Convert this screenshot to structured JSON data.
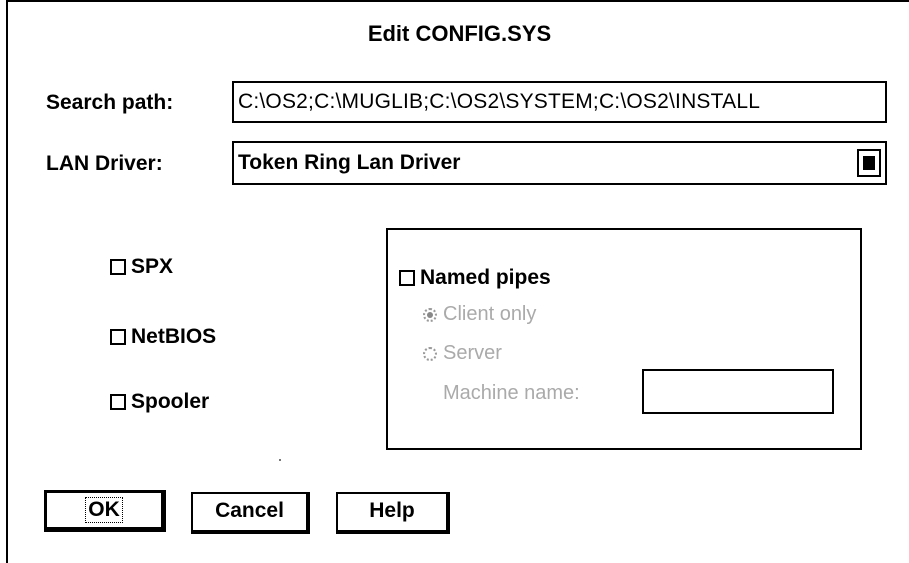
{
  "dialog": {
    "title": "Edit CONFIG.SYS"
  },
  "search_path": {
    "label": "Search path:",
    "value": "C:\\OS2;C:\\MUGLIB;C:\\OS2\\SYSTEM;C:\\OS2\\INSTALL"
  },
  "lan_driver": {
    "label": "LAN Driver:",
    "value": "Token Ring Lan Driver"
  },
  "checkboxes": {
    "spx": "SPX",
    "netbios": "NetBIOS",
    "spooler": "Spooler",
    "named_pipes": "Named pipes"
  },
  "named_pipes_group": {
    "client_only": "Client only",
    "server": "Server",
    "machine_name_label": "Machine name:",
    "machine_name_value": "",
    "selected": "client_only"
  },
  "buttons": {
    "ok": "OK",
    "cancel": "Cancel",
    "help": "Help"
  }
}
